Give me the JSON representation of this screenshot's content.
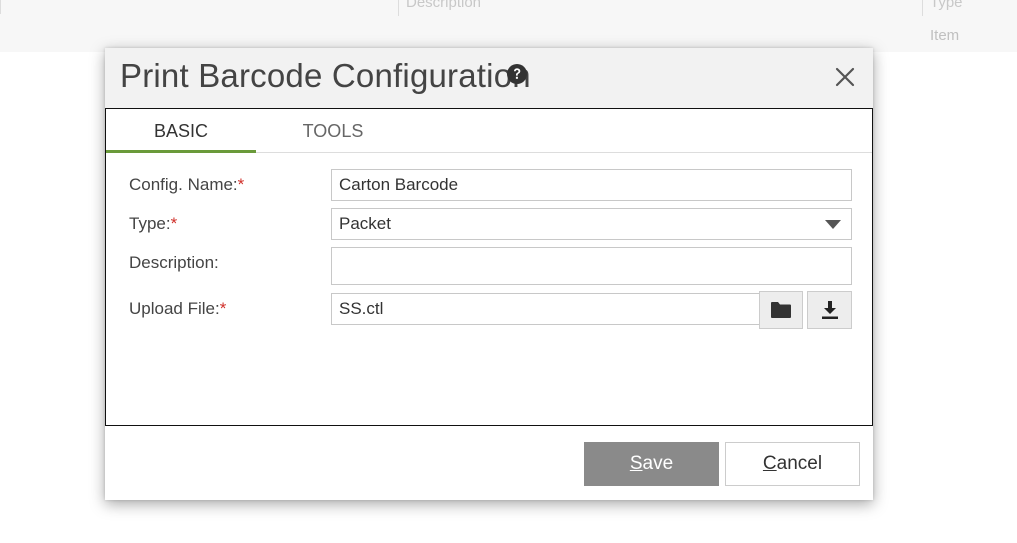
{
  "background": {
    "columns": [
      "Description",
      "Type"
    ],
    "row_value": "Item"
  },
  "dialog": {
    "title": "Print Barcode Configuration",
    "tabs": [
      {
        "label": "BASIC",
        "active": true
      },
      {
        "label": "TOOLS",
        "active": false
      }
    ],
    "fields": {
      "config_name": {
        "label": "Config. Name:",
        "required_mark": "*",
        "value": "Carton Barcode"
      },
      "type": {
        "label": "Type:",
        "required_mark": "*",
        "value": "Packet"
      },
      "description": {
        "label": "Description:",
        "value": ""
      },
      "upload_file": {
        "label": "Upload File:",
        "required_mark": "*",
        "value": "SS.ctl"
      }
    },
    "buttons": {
      "save": {
        "accesskey": "S",
        "rest": "ave"
      },
      "cancel": {
        "accesskey": "C",
        "rest": "ancel"
      }
    }
  },
  "colors": {
    "tab_active_underline": "#6a9a3a",
    "required": "#d0302a",
    "save_button": "#8a8a8a"
  },
  "icons": [
    "help-circle-icon",
    "close-icon",
    "folder-icon",
    "download-icon"
  ]
}
